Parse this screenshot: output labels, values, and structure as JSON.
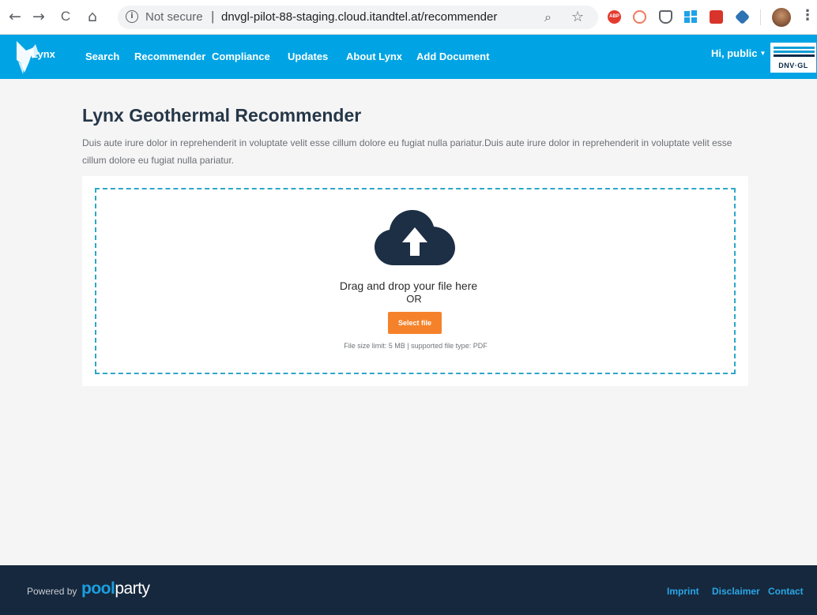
{
  "browser": {
    "back_glyph": "←",
    "forward_glyph": "→",
    "reload_glyph": "C",
    "home_glyph": "⌂",
    "security_label": "Not secure",
    "separator": "|",
    "url": "dnvgl-pilot-88-staging.cloud.itandtel.at/recommender",
    "zoom_glyph": "⌕",
    "star_glyph": "☆",
    "abp_label": "ABP",
    "menu_glyph": "⋮",
    "extensions": [
      "adblock-plus-icon",
      "noscript-icon",
      "pocket-icon",
      "windows-icon",
      "red-extension-icon",
      "hex-extension-icon"
    ]
  },
  "nav": {
    "brand": "Lynx",
    "links": [
      "Search",
      "Recommender",
      "Compliance",
      "Updates",
      "About Lynx",
      "Add Document"
    ],
    "user_greeting": "Hi, public",
    "caret": "▼",
    "partner_logo_text": "DNV·GL",
    "accent_color": "#00a4e4"
  },
  "main": {
    "title": "Lynx Geothermal Recommender",
    "description": "Duis aute irure dolor in reprehenderit in voluptate velit esse cillum dolore eu fugiat nulla pariatur.Duis aute irure dolor in reprehenderit in voluptate velit esse cillum dolore eu fugiat nulla pariatur."
  },
  "upload": {
    "drag_text": "Drag and drop your file here",
    "or_text": "OR",
    "button_label": "Select file",
    "hint": "File size limit: 5 MB | supported file type: PDF",
    "button_color": "#f5822a",
    "icon": "cloud-upload-icon"
  },
  "footer": {
    "powered_by": "Powered by",
    "logo_part1": "pool",
    "logo_part2": "party",
    "links": [
      "Imprint",
      "Disclaimer",
      "Contact"
    ]
  }
}
